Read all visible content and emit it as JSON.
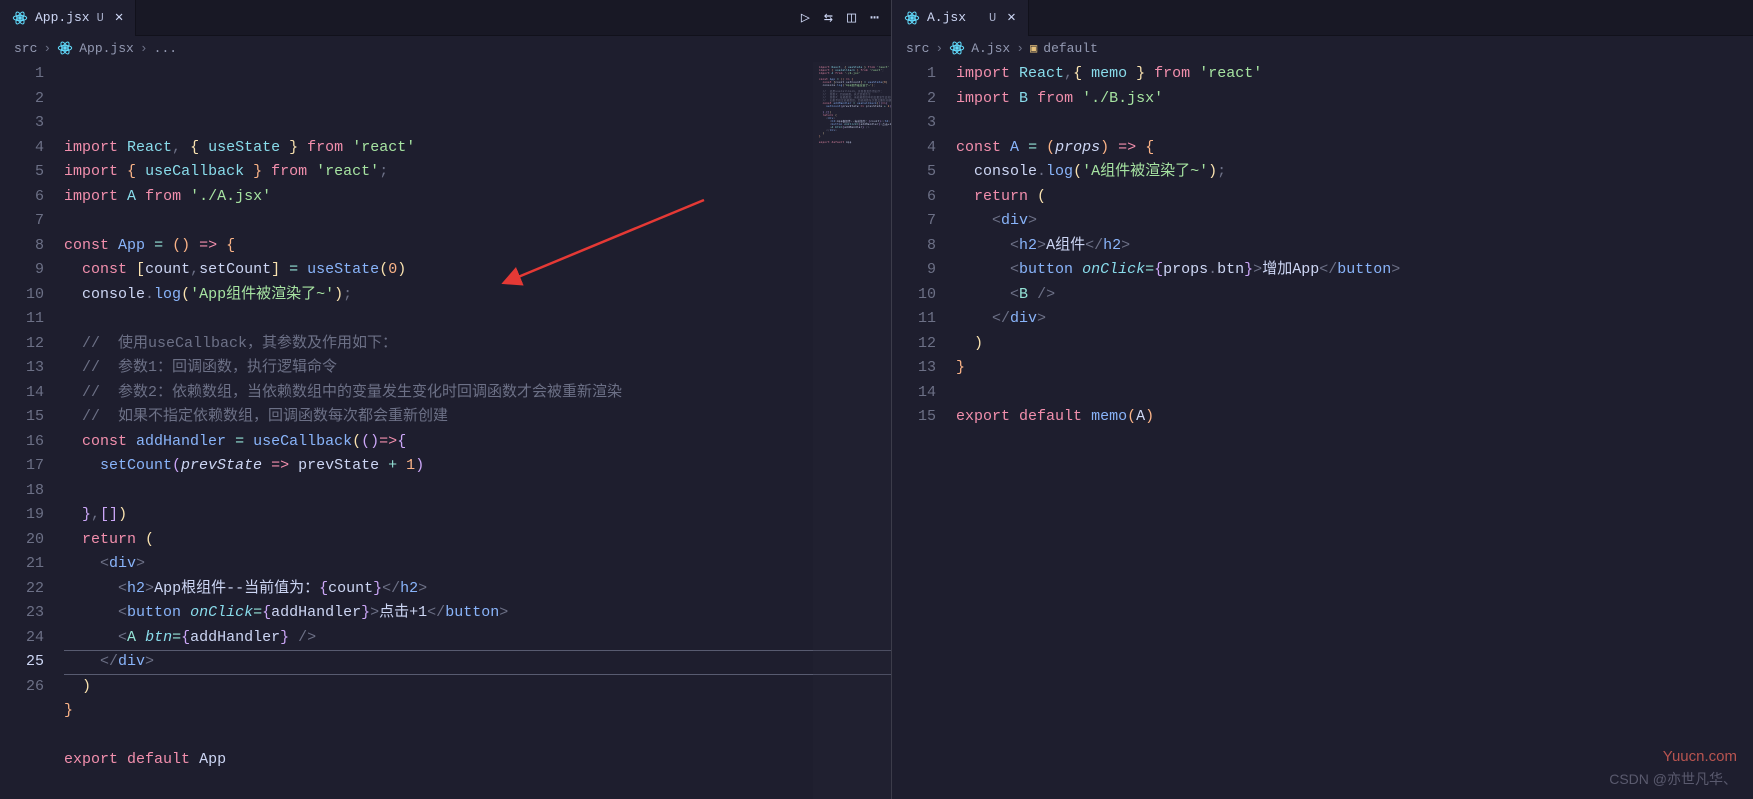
{
  "left": {
    "tab": {
      "filename": "App.jsx",
      "status": "U"
    },
    "breadcrumb": [
      "src",
      "App.jsx",
      "..."
    ],
    "lines": [
      {
        "n": 1,
        "h": "<span class='c-pink'>import</span> <span class='c-cyan'>React</span><span class='c-gray'>,</span> <span class='c-yellow'>{</span> <span class='c-cyan'>useState</span> <span class='c-yellow'>}</span> <span class='c-pink'>from</span> <span class='c-green'>'react'</span>"
      },
      {
        "n": 2,
        "h": "<span class='c-pink'>import</span> <span class='c-orange'>{</span> <span class='c-cyan'>useCallback</span> <span class='c-orange'>}</span> <span class='c-pink'>from</span> <span class='c-green'>'react'</span><span class='c-gray'>;</span>"
      },
      {
        "n": 3,
        "h": "<span class='c-pink'>import</span> <span class='c-cyan'>A</span> <span class='c-pink'>from</span> <span class='c-green'>'./A.jsx'</span>"
      },
      {
        "n": 4,
        "h": ""
      },
      {
        "n": 5,
        "h": "<span class='c-pink'>const</span> <span class='c-blue'>App</span> <span class='c-teal'>=</span> <span class='c-orange'>()</span> <span class='c-pink'>=&gt;</span> <span class='c-orange'>{</span>"
      },
      {
        "n": 6,
        "h": "  <span class='c-pink'>const</span> <span class='c-yellow'>[</span><span class='c-white'>count</span><span class='c-gray'>,</span><span class='c-white'>setCount</span><span class='c-yellow'>]</span> <span class='c-teal'>=</span> <span class='c-blue'>useState</span><span class='c-yellow'>(</span><span class='c-orange'>0</span><span class='c-yellow'>)</span>"
      },
      {
        "n": 7,
        "h": "  <span class='c-white'>console</span><span class='c-gray'>.</span><span class='c-blue'>log</span><span class='c-yellow'>(</span><span class='c-green'>'App组件被渲染了~'</span><span class='c-yellow'>)</span><span class='c-gray'>;</span>"
      },
      {
        "n": 8,
        "h": ""
      },
      {
        "n": 9,
        "h": "  <span class='c-gray'>//  使用useCallback，其参数及作用如下：</span>"
      },
      {
        "n": 10,
        "h": "  <span class='c-gray'>//  参数1：回调函数，执行逻辑命令</span>"
      },
      {
        "n": 11,
        "h": "  <span class='c-gray'>//  参数2：依赖数组，当依赖数组中的变量发生变化时回调函数才会被重新渲染</span>"
      },
      {
        "n": 12,
        "h": "  <span class='c-gray'>//  如果不指定依赖数组，回调函数每次都会重新创建</span>"
      },
      {
        "n": 13,
        "h": "  <span class='c-pink'>const</span> <span class='c-blue'>addHandler</span> <span class='c-teal'>=</span> <span class='c-blue'>useCallback</span><span class='c-yellow'>(</span><span class='c-purple'>()</span><span class='c-pink'>=&gt;</span><span class='c-purple'>{</span>"
      },
      {
        "n": 14,
        "h": "    <span class='c-blue'>setCount</span><span class='c-purple'>(</span><span class='c-white c-italic'>prevState</span> <span class='c-pink'>=&gt;</span> <span class='c-white'>prevState</span> <span class='c-teal'>+</span> <span class='c-orange'>1</span><span class='c-purple'>)</span>"
      },
      {
        "n": 15,
        "h": ""
      },
      {
        "n": 16,
        "h": "  <span class='c-purple'>}</span><span class='c-gray'>,</span><span class='c-purple'>[]</span><span class='c-yellow'>)</span>"
      },
      {
        "n": 17,
        "h": "  <span class='c-pink'>return</span> <span class='c-yellow'>(</span>"
      },
      {
        "n": 18,
        "h": "    <span class='c-gray'>&lt;</span><span class='c-blue'>div</span><span class='c-gray'>&gt;</span>"
      },
      {
        "n": 19,
        "h": "      <span class='c-gray'>&lt;</span><span class='c-blue'>h2</span><span class='c-gray'>&gt;</span><span class='c-white'>App根组件--当前值为：</span><span class='c-purple'>{</span><span class='c-white'>count</span><span class='c-purple'>}</span><span class='c-gray'>&lt;/</span><span class='c-blue'>h2</span><span class='c-gray'>&gt;</span>"
      },
      {
        "n": 20,
        "h": "      <span class='c-gray'>&lt;</span><span class='c-blue'>button</span> <span class='c-cyan c-italic'>onClick</span><span class='c-teal'>=</span><span class='c-purple'>{</span><span class='c-white'>addHandler</span><span class='c-purple'>}</span><span class='c-gray'>&gt;</span><span class='c-white'>点击+1</span><span class='c-gray'>&lt;/</span><span class='c-blue'>button</span><span class='c-gray'>&gt;</span>"
      },
      {
        "n": 21,
        "h": "      <span class='c-gray'>&lt;</span><span class='c-teal'>A</span> <span class='c-cyan c-italic'>btn</span><span class='c-teal'>=</span><span class='c-purple'>{</span><span class='c-white'>addHandler</span><span class='c-purple'>}</span> <span class='c-gray'>/&gt;</span>"
      },
      {
        "n": 22,
        "h": "    <span class='c-gray'>&lt;/</span><span class='c-blue'>div</span><span class='c-gray'>&gt;</span>"
      },
      {
        "n": 23,
        "h": "  <span class='c-yellow'>)</span>"
      },
      {
        "n": 24,
        "h": "<span class='c-orange'>}</span>"
      },
      {
        "n": 25,
        "h": "",
        "cur": true
      },
      {
        "n": 26,
        "h": "<span class='c-pink'>export</span> <span class='c-pink'>default</span> <span class='c-white'>App</span>"
      }
    ]
  },
  "right": {
    "tab": {
      "filename": "A.jsx",
      "status": "U"
    },
    "breadcrumb": [
      "src",
      "A.jsx",
      "default"
    ],
    "lines": [
      {
        "n": 1,
        "h": "<span class='c-pink'>import</span> <span class='c-cyan'>React</span><span class='c-gray'>,</span><span class='c-yellow'>{</span> <span class='c-cyan'>memo</span> <span class='c-yellow'>}</span> <span class='c-pink'>from</span> <span class='c-green'>'react'</span>"
      },
      {
        "n": 2,
        "h": "<span class='c-pink'>import</span> <span class='c-cyan'>B</span> <span class='c-pink'>from</span> <span class='c-green'>'./B.jsx'</span>"
      },
      {
        "n": 3,
        "h": ""
      },
      {
        "n": 4,
        "h": "<span class='c-pink'>const</span> <span class='c-blue'>A</span> <span class='c-teal'>=</span> <span class='c-orange'>(</span><span class='c-white c-italic'>props</span><span class='c-orange'>)</span> <span class='c-pink'>=&gt;</span> <span class='c-orange'>{</span>"
      },
      {
        "n": 5,
        "h": "  <span class='c-white'>console</span><span class='c-gray'>.</span><span class='c-blue'>log</span><span class='c-yellow'>(</span><span class='c-green'>'A组件被渲染了~'</span><span class='c-yellow'>)</span><span class='c-gray'>;</span>"
      },
      {
        "n": 6,
        "h": "  <span class='c-pink'>return</span> <span class='c-yellow'>(</span>"
      },
      {
        "n": 7,
        "h": "    <span class='c-gray'>&lt;</span><span class='c-blue'>div</span><span class='c-gray'>&gt;</span>"
      },
      {
        "n": 8,
        "h": "      <span class='c-gray'>&lt;</span><span class='c-blue'>h2</span><span class='c-gray'>&gt;</span><span class='c-white'>A组件</span><span class='c-gray'>&lt;/</span><span class='c-blue'>h2</span><span class='c-gray'>&gt;</span>"
      },
      {
        "n": 9,
        "h": "      <span class='c-gray'>&lt;</span><span class='c-blue'>button</span> <span class='c-cyan c-italic'>onClick</span><span class='c-teal'>=</span><span class='c-purple'>{</span><span class='c-white'>props</span><span class='c-gray'>.</span><span class='c-white'>btn</span><span class='c-purple'>}</span><span class='c-gray'>&gt;</span><span class='c-white'>增加App</span><span class='c-gray'>&lt;/</span><span class='c-blue'>button</span><span class='c-gray'>&gt;</span>"
      },
      {
        "n": 10,
        "h": "      <span class='c-gray'>&lt;</span><span class='c-teal'>B</span> <span class='c-gray'>/&gt;</span>"
      },
      {
        "n": 11,
        "h": "    <span class='c-gray'>&lt;/</span><span class='c-blue'>div</span><span class='c-gray'>&gt;</span>"
      },
      {
        "n": 12,
        "h": "  <span class='c-yellow'>)</span>"
      },
      {
        "n": 13,
        "h": "<span class='c-orange'>}</span>"
      },
      {
        "n": 14,
        "h": ""
      },
      {
        "n": 15,
        "h": "<span class='c-pink'>export</span> <span class='c-pink'>default</span> <span class='c-blue'>memo</span><span class='c-orange'>(</span><span class='c-white'>A</span><span class='c-orange'>)</span>"
      }
    ]
  },
  "watermark": {
    "line1": "Yuucn.com",
    "line2": "CSDN @亦世凡华、"
  }
}
